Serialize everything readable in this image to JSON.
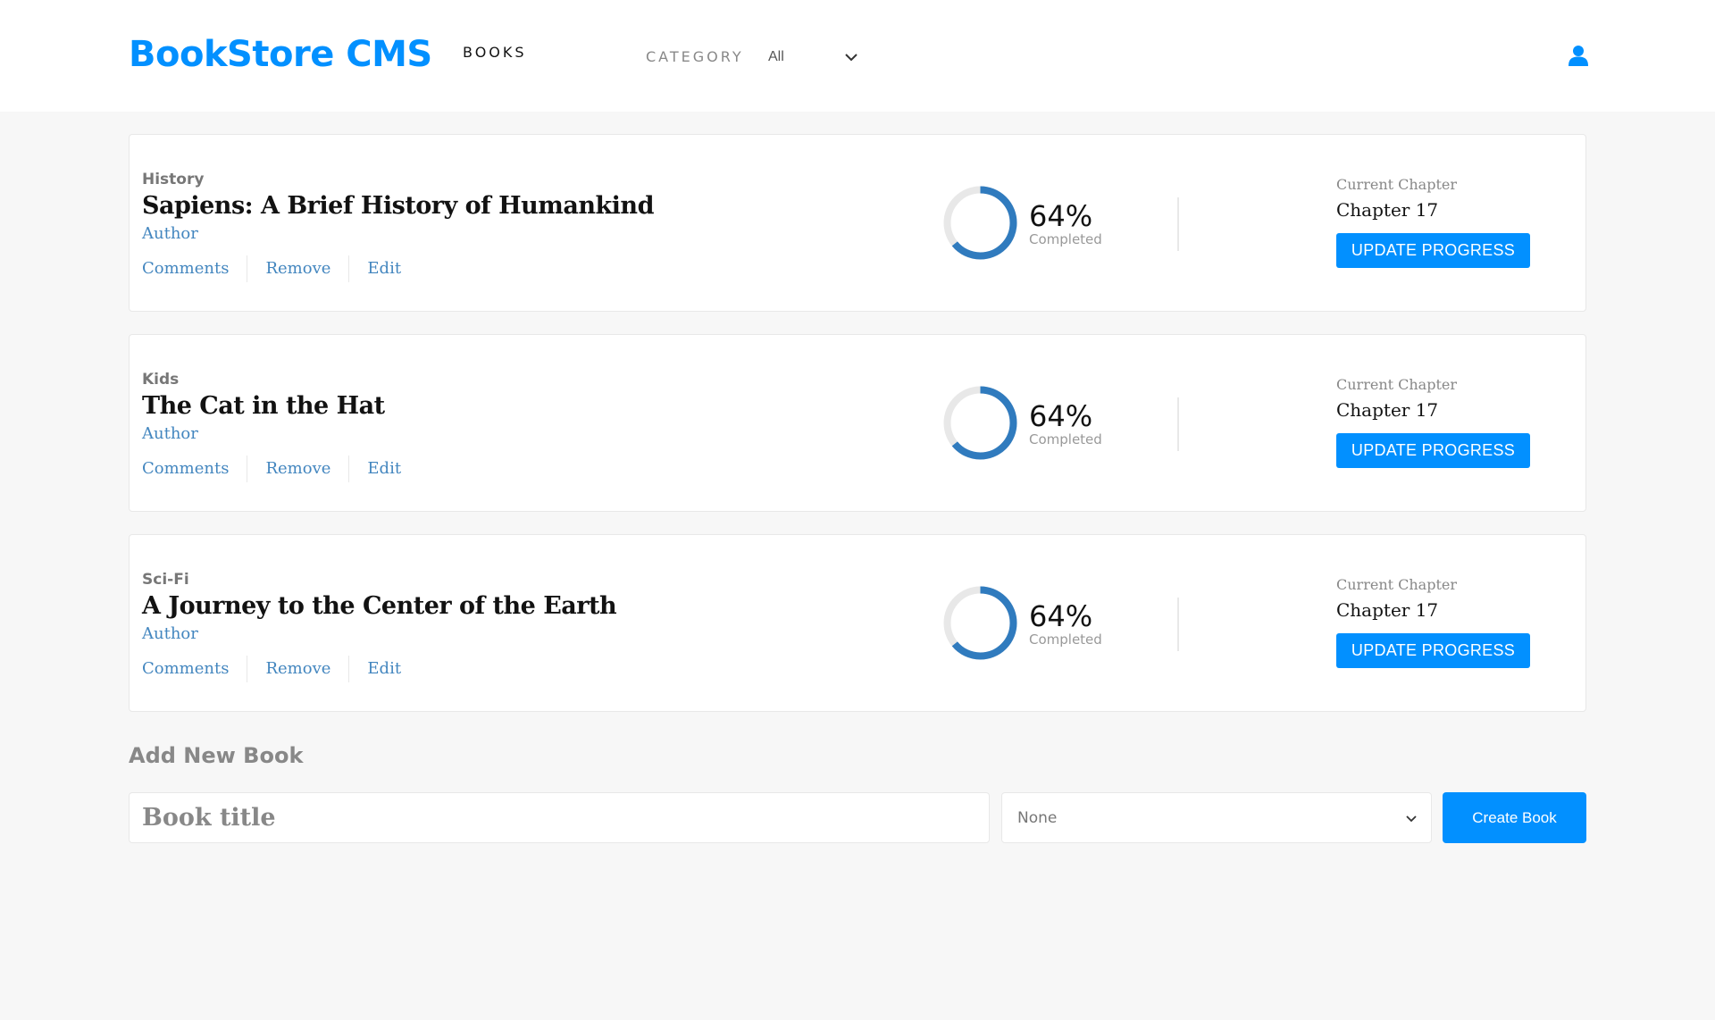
{
  "header": {
    "logo": "BookStore CMS",
    "nav_books": "BOOKS",
    "category_label": "CATEGORY",
    "category_value": "All",
    "user_icon": "user-icon"
  },
  "books": [
    {
      "genre": "History",
      "title": "Sapiens: A Brief History of Humankind",
      "author": "Author",
      "actions": [
        "Comments",
        "Remove",
        "Edit"
      ],
      "progress_percent": 64,
      "progress_text": "64%",
      "completed_label": "Completed",
      "current_chapter_label": "Current Chapter",
      "current_chapter": "Chapter 17",
      "update_label": "UPDATE PROGRESS"
    },
    {
      "genre": "Kids",
      "title": "The Cat in the Hat",
      "author": "Author",
      "actions": [
        "Comments",
        "Remove",
        "Edit"
      ],
      "progress_percent": 64,
      "progress_text": "64%",
      "completed_label": "Completed",
      "current_chapter_label": "Current Chapter",
      "current_chapter": "Chapter 17",
      "update_label": "UPDATE PROGRESS"
    },
    {
      "genre": "Sci-Fi",
      "title": "A Journey to the Center of the Earth",
      "author": "Author",
      "actions": [
        "Comments",
        "Remove",
        "Edit"
      ],
      "progress_percent": 64,
      "progress_text": "64%",
      "completed_label": "Completed",
      "current_chapter_label": "Current Chapter",
      "current_chapter": "Chapter 17",
      "update_label": "UPDATE PROGRESS"
    }
  ],
  "add_book": {
    "heading": "Add New Book",
    "title_placeholder": "Book title",
    "category_value": "None",
    "create_label": "Create Book"
  },
  "colors": {
    "accent": "#0290ff",
    "progress_ring": "#307bbe",
    "ring_track": "#e8e8e8"
  }
}
